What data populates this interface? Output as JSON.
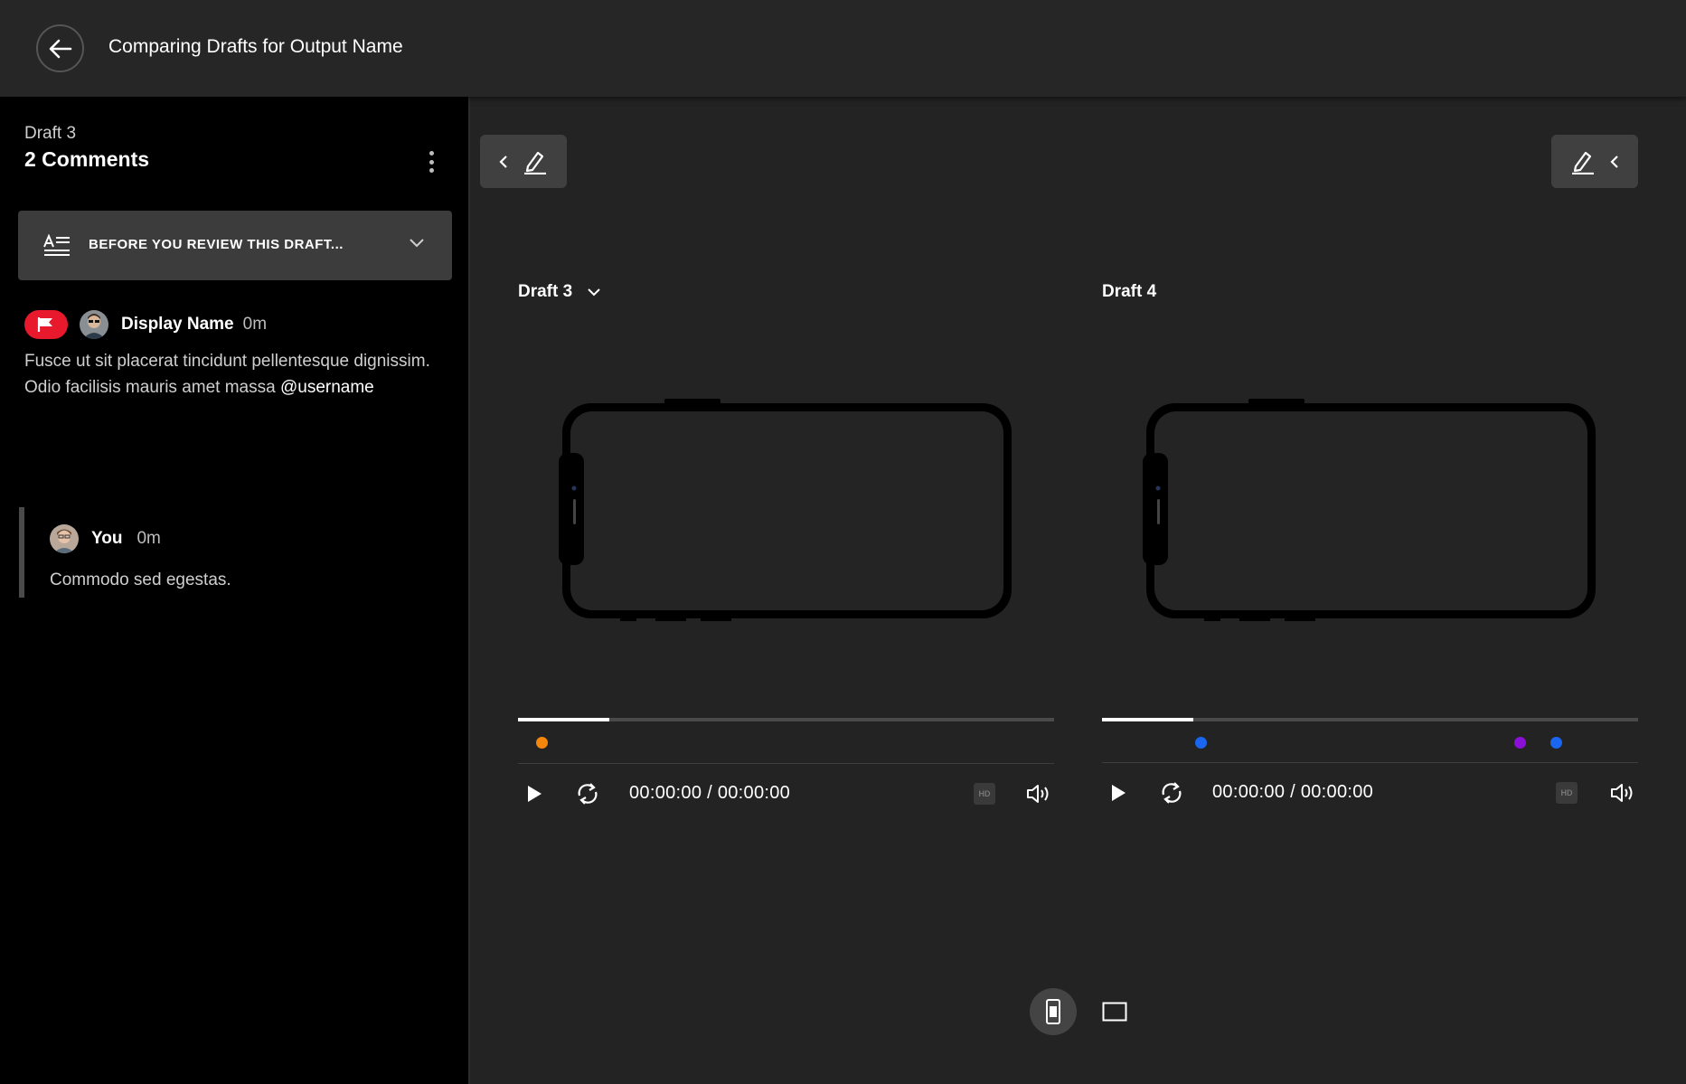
{
  "header": {
    "title": "Comparing Drafts for Output Name",
    "back_icon": "arrow-left-icon"
  },
  "sidebar": {
    "draft_label": "Draft 3",
    "comment_count": "2 Comments",
    "review_banner": {
      "label": "BEFORE YOU REVIEW THIS DRAFT..."
    },
    "comments": [
      {
        "author": "Display Name",
        "time": "0m",
        "flagged": true,
        "text": "Fusce ut sit placerat tincidunt pellentesque dignissim. Odio facilisis mauris amet massa ",
        "mention": "@username",
        "replies": [
          {
            "author": "You",
            "time": "0m",
            "text": "Commodo sed egestas."
          }
        ]
      }
    ]
  },
  "players": [
    {
      "label": "Draft 3",
      "has_dropdown": true,
      "time": "00:00:00 / 00:00:00",
      "progress": 0.17,
      "markers": [
        {
          "position": 0.045,
          "color": "#f5860c"
        }
      ],
      "hd_label": "HD"
    },
    {
      "label": "Draft 4",
      "has_dropdown": false,
      "time": "00:00:00 / 00:00:00",
      "progress": 0.17,
      "markers": [
        {
          "position": 0.185,
          "color": "#1a66f0"
        },
        {
          "position": 0.78,
          "color": "#8a10d8"
        },
        {
          "position": 0.848,
          "color": "#1a66f0"
        }
      ],
      "hd_label": "HD"
    }
  ],
  "colors": {
    "accent_red": "#e8192c",
    "background": "#232323",
    "sidebar": "#000000"
  },
  "view_modes": [
    {
      "name": "portrait",
      "active": true
    },
    {
      "name": "landscape",
      "active": false
    }
  ]
}
